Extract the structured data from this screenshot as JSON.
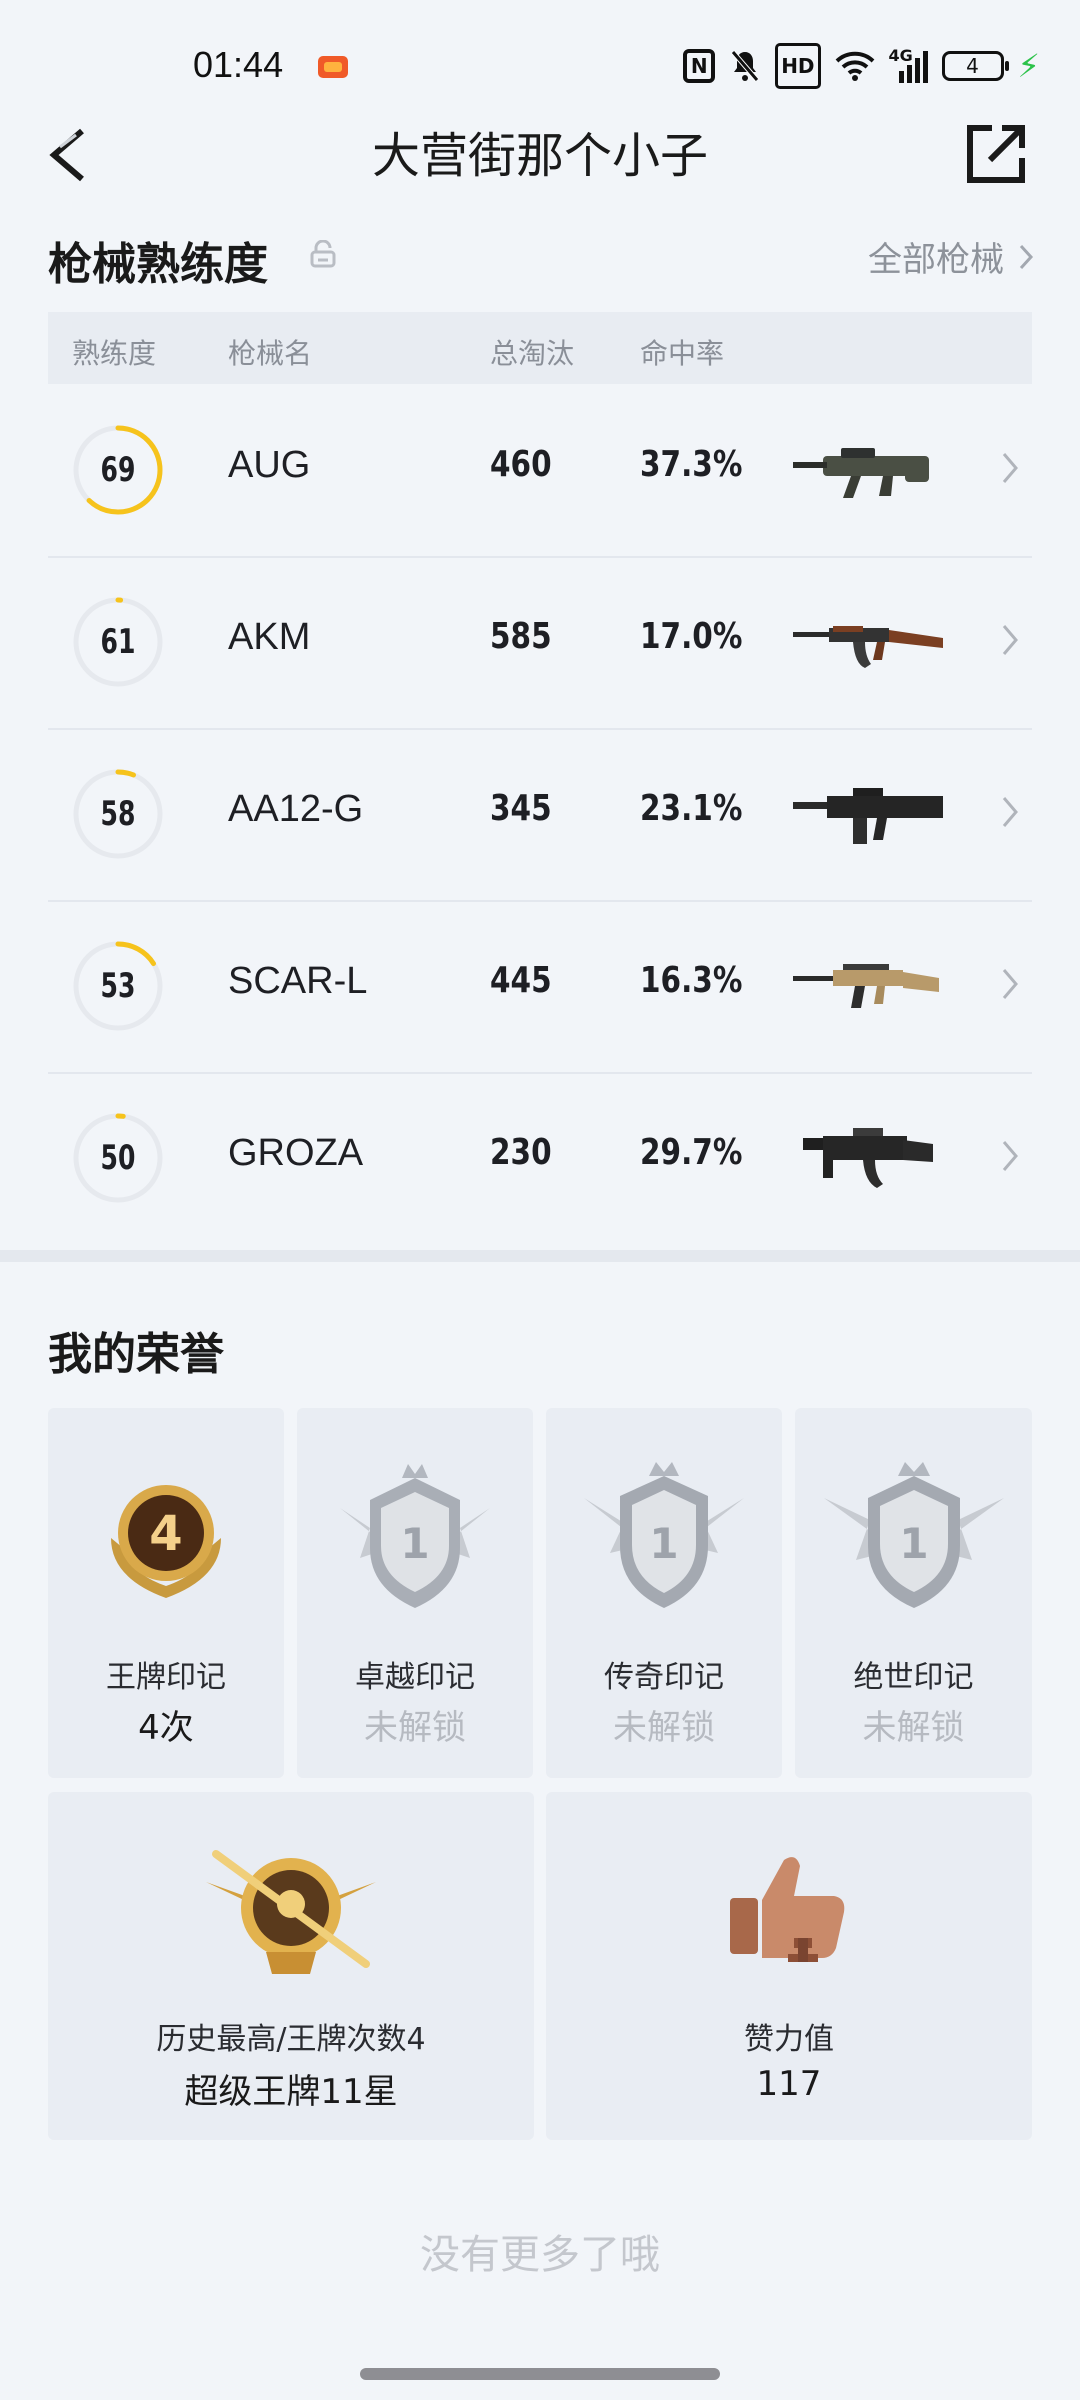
{
  "status_bar": {
    "time": "01:44",
    "hd": "HD",
    "network": "4G",
    "battery": "4"
  },
  "header": {
    "title": "大营街那个小子"
  },
  "weapons": {
    "title": "枪械熟练度",
    "all_link": "全部枪械",
    "columns": {
      "proficiency": "熟练度",
      "name": "枪械名",
      "kills": "总淘汰",
      "hit_rate": "命中率"
    },
    "rows": [
      {
        "level": "69",
        "progress": 0.62,
        "name": "AUG",
        "kills": "460",
        "hit_rate": "37.3%",
        "icon": "aug-rifle-icon"
      },
      {
        "level": "61",
        "progress": 0.01,
        "name": "AKM",
        "kills": "585",
        "hit_rate": "17.0%",
        "icon": "akm-rifle-icon"
      },
      {
        "level": "58",
        "progress": 0.06,
        "name": "AA12-G",
        "kills": "345",
        "hit_rate": "23.1%",
        "icon": "aa12-shotgun-icon"
      },
      {
        "level": "53",
        "progress": 0.16,
        "name": "SCAR-L",
        "kills": "445",
        "hit_rate": "16.3%",
        "icon": "scar-rifle-icon"
      },
      {
        "level": "50",
        "progress": 0.02,
        "name": "GROZA",
        "kills": "230",
        "hit_rate": "29.7%",
        "icon": "groza-rifle-icon"
      }
    ],
    "ring_color": "#f6c31c",
    "ring_track": "#e6e9ee"
  },
  "honors": {
    "title": "我的荣誉",
    "marks": [
      {
        "label": "王牌印记",
        "value": "4次",
        "badge_number": "4",
        "locked": false
      },
      {
        "label": "卓越印记",
        "value": "未解锁",
        "badge_number": "1",
        "locked": true
      },
      {
        "label": "传奇印记",
        "value": "未解锁",
        "badge_number": "1",
        "locked": true
      },
      {
        "label": "绝世印记",
        "value": "未解锁",
        "badge_number": "1",
        "locked": true
      }
    ],
    "best": {
      "label": "历史最高/王牌次数4",
      "value": "超级王牌11星"
    },
    "likes": {
      "label": "赞力值",
      "value": "117"
    }
  },
  "footer": {
    "no_more": "没有更多了哦"
  }
}
